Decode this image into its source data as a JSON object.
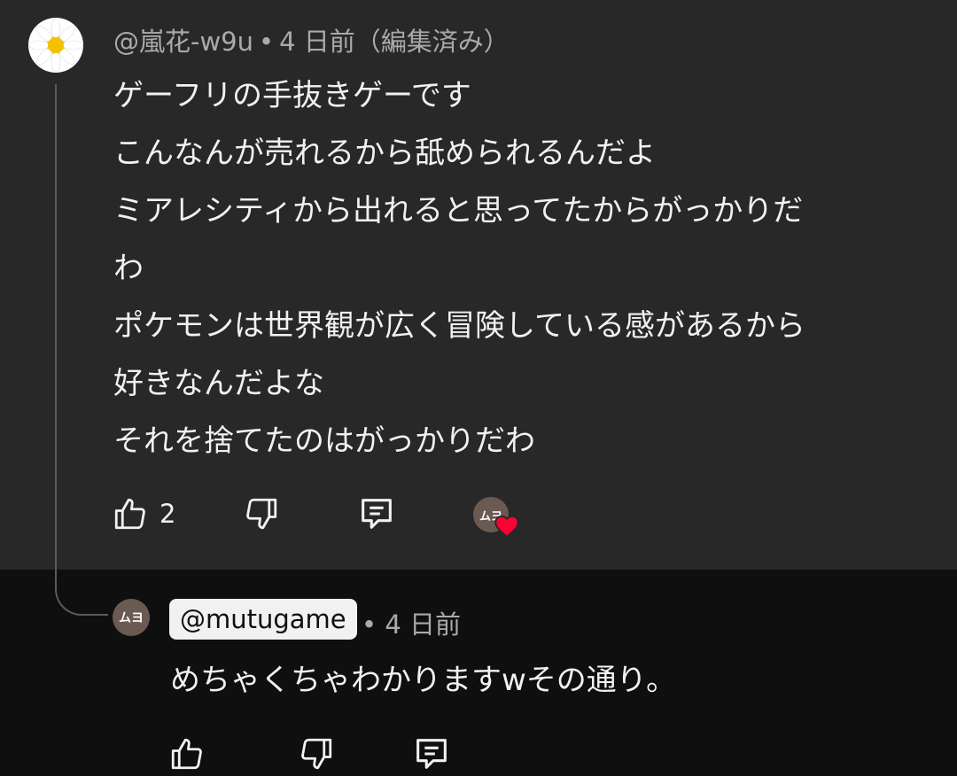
{
  "comment": {
    "author": "@嵐花-w9u",
    "separator": "•",
    "time": "4 日前（編集済み）",
    "lines": [
      "ゲーフリの手抜きゲーです",
      "こんなんが売れるから舐められるんだよ",
      "ミアレシティから出れると思ってたからがっかりだ",
      "わ",
      "ポケモンは世界観が広く冒険している感があるから",
      "好きなんだよな",
      "それを捨てたのはがっかりだわ"
    ],
    "like_count": "2",
    "avatar_icon": "daisy-flower",
    "creator_badge": "ムヨ"
  },
  "reply": {
    "author": "@mutugame",
    "separator": "•",
    "time": "4 日前",
    "text": "めちゃくちゃわかりますwその通り。",
    "avatar_label": "ムヨ"
  },
  "colors": {
    "comment_bg": "#282828",
    "page_bg": "#0f0f0f",
    "text": "#f1f1f1",
    "muted": "#aaaaaa",
    "heart": "#ff0033"
  }
}
